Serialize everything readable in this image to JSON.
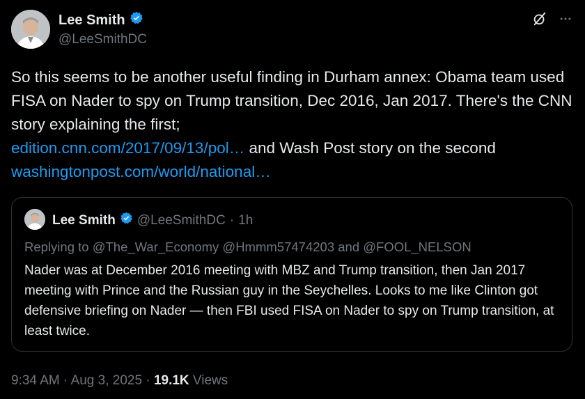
{
  "author": {
    "display_name": "Lee Smith",
    "handle": "@LeeSmithDC",
    "verified": true,
    "verified_color": "#1d9bf0"
  },
  "icons": {
    "grok": "grok-icon",
    "more": "more-icon"
  },
  "tweet": {
    "text_1": "So this seems to be another useful finding in Durham annex: Obama team used FISA on Nader to spy on Trump transition, Dec 2016, Jan 2017. There's the CNN story explaining the first;",
    "link_1": "edition.cnn.com/2017/09/13/pol…",
    "text_2": " and Wash Post story on the second",
    "link_2": "washingtonpost.com/world/national…"
  },
  "quote": {
    "display_name": "Lee Smith",
    "handle": "@LeeSmithDC",
    "separator": "·",
    "time": "1h",
    "replying_prefix": "Replying to",
    "replying_handles": "@The_War_Economy @Hmmm57474203 and @FOOL_NELSON",
    "text": "Nader was at December 2016 meeting with MBZ and Trump transition, then Jan 2017 meeting with Prince and the Russian guy in the Seychelles. Looks to me like Clinton got defensive briefing on Nader — then FBI used FISA on Nader to spy on Trump transition, at least twice."
  },
  "footer": {
    "time": "9:34 AM",
    "separator": "·",
    "date": "Aug 3, 2025",
    "views_count": "19.1K",
    "views_label": "Views"
  },
  "colors": {
    "background": "#000000",
    "text": "#e7e9ea",
    "muted": "#71767b",
    "link": "#1d9bf0",
    "border": "#2f3336"
  }
}
